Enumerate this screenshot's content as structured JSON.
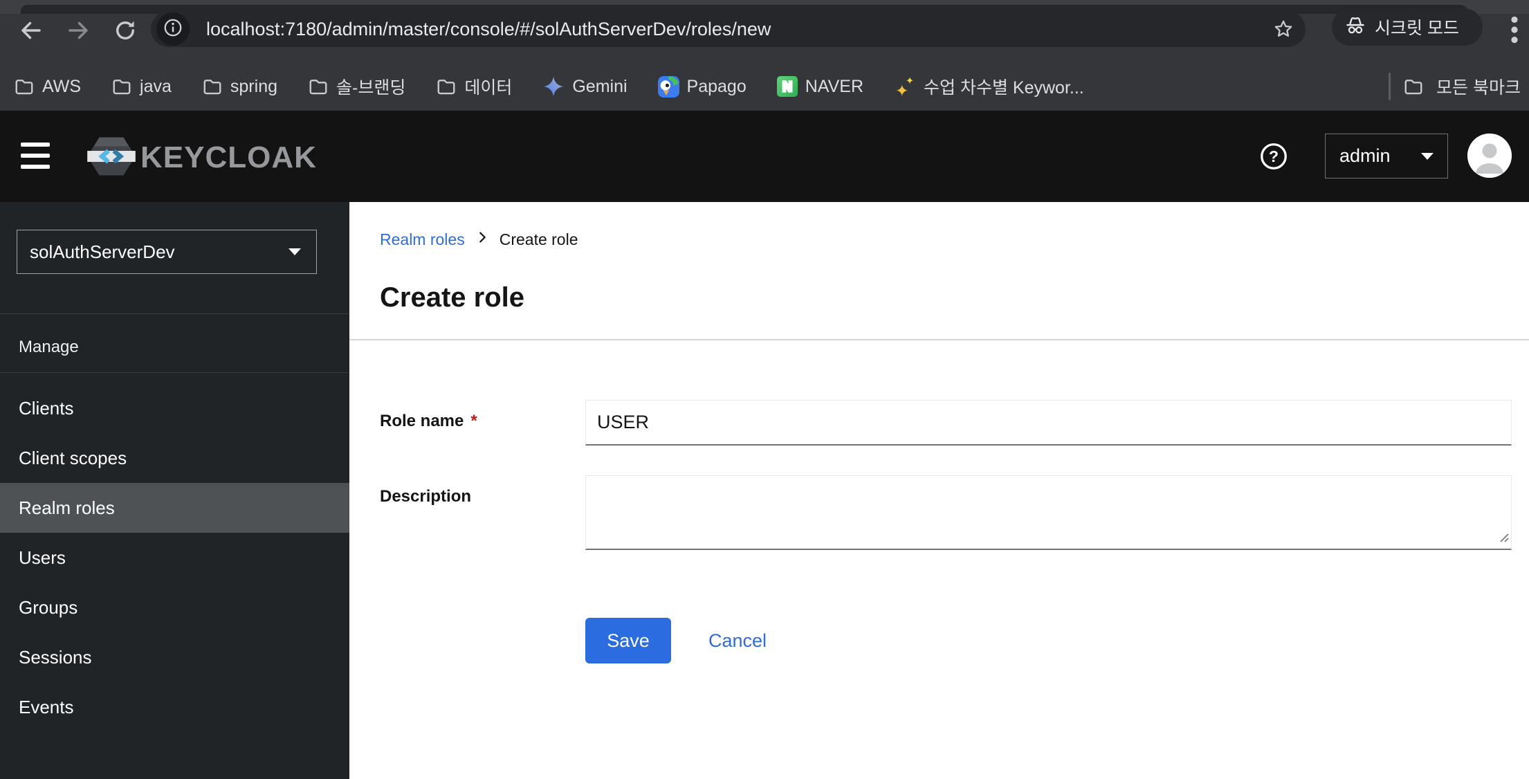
{
  "browser": {
    "url": "localhost:7180/admin/master/console/#/solAuthServerDev/roles/new",
    "incognito_badge": "시크릿 모드",
    "bookmarks_bar": {
      "items": [
        {
          "label": "AWS",
          "icon": "folder"
        },
        {
          "label": "java",
          "icon": "folder"
        },
        {
          "label": "spring",
          "icon": "folder"
        },
        {
          "label": "솔-브랜딩",
          "icon": "folder"
        },
        {
          "label": "데이터",
          "icon": "folder"
        },
        {
          "label": "Gemini",
          "icon": "gemini"
        },
        {
          "label": "Papago",
          "icon": "papago"
        },
        {
          "label": "NAVER",
          "icon": "naver"
        },
        {
          "label": "수업 차수별 Keywor...",
          "icon": "sparkles"
        }
      ],
      "all_bookmarks_label": "모든 북마크"
    }
  },
  "keycloak": {
    "masthead": {
      "brand": "KEYCLOAK",
      "username": "admin"
    },
    "sidebar": {
      "realm_selector": "solAuthServerDev",
      "section_label": "Manage",
      "active_item": "Realm roles",
      "items": [
        "Clients",
        "Client scopes",
        "Realm roles",
        "Users",
        "Groups",
        "Sessions",
        "Events"
      ]
    },
    "page": {
      "breadcrumb": {
        "parent": "Realm roles",
        "current": "Create role"
      },
      "title": "Create role",
      "form": {
        "role_name": {
          "label": "Role name",
          "required_marker": "*",
          "value": "USER"
        },
        "description": {
          "label": "Description",
          "value": ""
        },
        "actions": {
          "save": "Save",
          "cancel": "Cancel"
        }
      }
    }
  },
  "colors": {
    "chrome_bg": "#35363a",
    "chrome_pill_bg": "#26272a",
    "masthead_bg": "#131314",
    "sidebar_bg": "#212427",
    "sidebar_active_bg": "#4f5255",
    "primary_blue": "#2b6ce0",
    "link_blue": "#2e6ce0",
    "required_red": "#c9190b",
    "naver_green": "#3ec464"
  }
}
